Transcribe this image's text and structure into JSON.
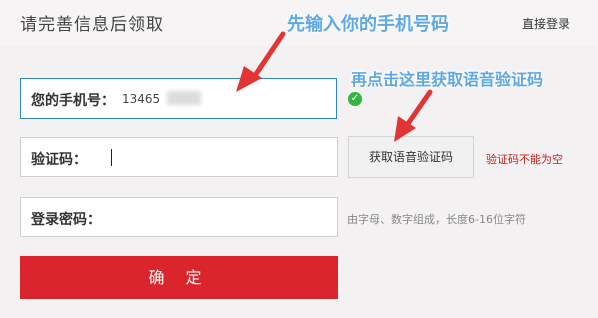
{
  "header": {
    "title": "请完善信息后领取",
    "direct_login": "直接登录"
  },
  "form": {
    "phone_label": "您的手机号：",
    "phone_value": "13465",
    "code_label": "验证码：",
    "password_label": "登录密码：",
    "voice_code_button": "获取语音验证码",
    "code_error": "验证码不能为空",
    "password_hint": "由字母、数字组成，长度6-16位字符",
    "confirm_button": "确 定"
  },
  "annotations": {
    "step1": "先输入你的手机号码",
    "step2": "再点击这里获取语音验证码"
  },
  "colors": {
    "accent_red": "#d9252b",
    "annotation_blue": "#5fa8e6",
    "arrow_red": "#e23434",
    "focus_border": "#2f86c9",
    "success_green": "#35b442"
  },
  "icons": {
    "valid": "check-circle-icon"
  }
}
